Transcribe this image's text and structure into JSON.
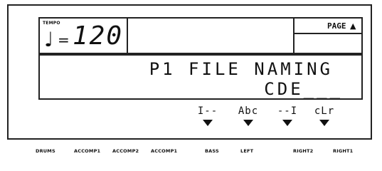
{
  "tempo": {
    "label": "TEMPO",
    "note_glyph": "♩",
    "eq": "=",
    "value": "120"
  },
  "page": {
    "label": "PAGE",
    "arrow": "▲"
  },
  "message": {
    "line1": "P1 FILE NAMING",
    "line2": "CDE___"
  },
  "softkeys": [
    {
      "label": "I--"
    },
    {
      "label": "Abc"
    },
    {
      "label": "--I"
    },
    {
      "label": "cLr"
    }
  ],
  "bottom_labels": [
    "DRUMS",
    "ACCOMP1",
    "ACCOMP2",
    "ACCOMP1",
    "BASS",
    "LEFT",
    "RIGHT2",
    "RIGHT1"
  ]
}
